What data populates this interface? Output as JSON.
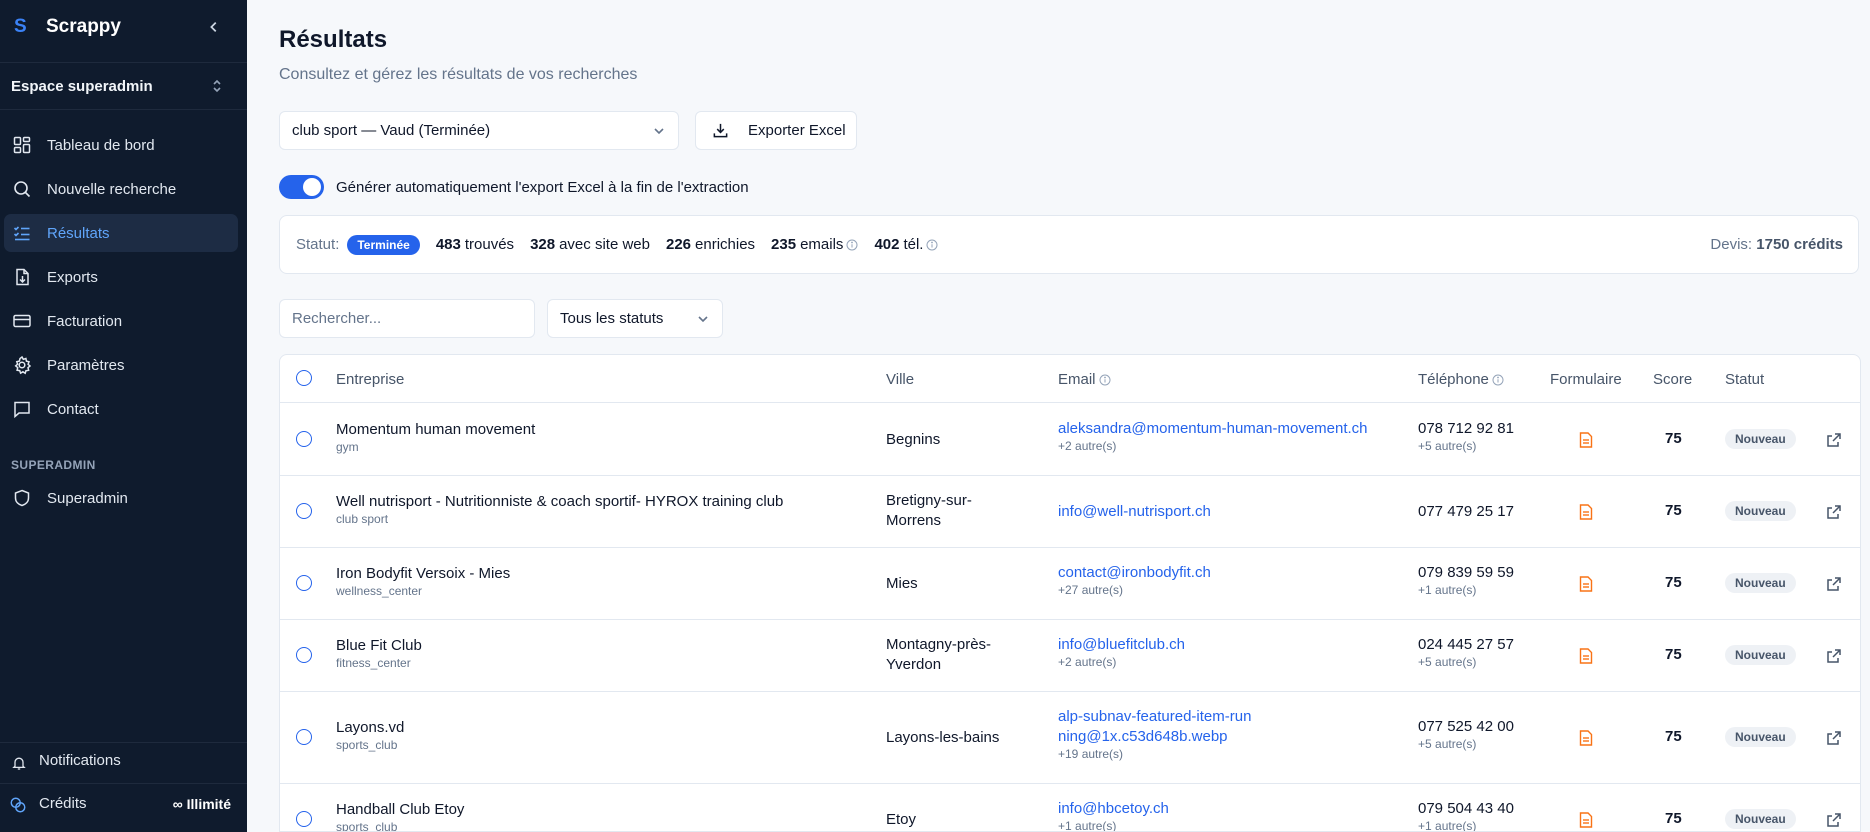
{
  "sidebar": {
    "logo": "S",
    "app_name": "Scrappy",
    "workspace": "Espace superadmin",
    "nav": [
      {
        "label": "Tableau de bord",
        "icon": "dashboard-icon"
      },
      {
        "label": "Nouvelle recherche",
        "icon": "search-icon"
      },
      {
        "label": "Résultats",
        "icon": "list-check-icon",
        "active": true
      },
      {
        "label": "Exports",
        "icon": "file-download-icon"
      },
      {
        "label": "Facturation",
        "icon": "credit-card-icon"
      },
      {
        "label": "Paramètres",
        "icon": "gear-icon"
      },
      {
        "label": "Contact",
        "icon": "chat-icon"
      }
    ],
    "section_label": "SUPERADMIN",
    "superadmin_label": "Superadmin",
    "notifications_label": "Notifications",
    "credits_label": "Crédits",
    "credits_value": "∞ Illimité"
  },
  "header": {
    "title": "Résultats",
    "subtitle": "Consultez et gérez les résultats de vos recherches"
  },
  "search_select": {
    "value": "club sport — Vaud (Terminée)"
  },
  "export_button": {
    "label": "Exporter Excel"
  },
  "auto_export": {
    "label": "Générer automatiquement l'export Excel à la fin de l'extraction",
    "enabled": true
  },
  "stats": {
    "status_label": "Statut:",
    "status_value": "Terminée",
    "found": {
      "value": "483",
      "label": "trouvés"
    },
    "with_site": {
      "value": "328",
      "label": "avec site web"
    },
    "enriched": {
      "value": "226",
      "label": "enrichies"
    },
    "emails": {
      "value": "235",
      "label": "emails"
    },
    "phones": {
      "value": "402",
      "label": "tél."
    },
    "quote_label": "Devis:",
    "quote_value": "1750 crédits"
  },
  "filters": {
    "search_placeholder": "Rechercher...",
    "status_value": "Tous les statuts"
  },
  "table": {
    "columns": {
      "company": "Entreprise",
      "city": "Ville",
      "email": "Email",
      "phone": "Téléphone",
      "form": "Formulaire",
      "score": "Score",
      "status": "Statut"
    },
    "rows": [
      {
        "name": "Momentum human movement",
        "category": "gym",
        "city": "Begnins",
        "email": "aleksandra@momentum-human-movement.ch",
        "email_more": "+2 autre(s)",
        "phone": "078 712 92 81",
        "phone_more": "+5 autre(s)",
        "score": "75",
        "status": "Nouveau"
      },
      {
        "name": "Well nutrisport - Nutritionniste & coach sportif- HYROX training club",
        "category": "club sport",
        "city": "Bretigny-sur-Morrens",
        "email": "info@well-nutrisport.ch",
        "email_more": "",
        "phone": "077 479 25 17",
        "phone_more": "",
        "score": "75",
        "status": "Nouveau"
      },
      {
        "name": "Iron Bodyfit Versoix - Mies",
        "category": "wellness_center",
        "city": "Mies",
        "email": "contact@ironbodyfit.ch",
        "email_more": "+27 autre(s)",
        "phone": "079 839 59 59",
        "phone_more": "+1 autre(s)",
        "score": "75",
        "status": "Nouveau"
      },
      {
        "name": "Blue Fit Club",
        "category": "fitness_center",
        "city": "Montagny-près-Yverdon",
        "email": "info@bluefitclub.ch",
        "email_more": "+2 autre(s)",
        "phone": "024 445 27 57",
        "phone_more": "+5 autre(s)",
        "score": "75",
        "status": "Nouveau"
      },
      {
        "name": "Layons.vd",
        "category": "sports_club",
        "city": "Layons-les-bains",
        "email": "alp-subnav-featured-item-running@1x.c53d648b.webp",
        "email_more": "+19 autre(s)",
        "phone": "077 525 42 00",
        "phone_more": "+5 autre(s)",
        "score": "75",
        "status": "Nouveau"
      },
      {
        "name": "Handball Club Etoy",
        "category": "sports_club",
        "city": "Etoy",
        "email": "info@hbcetoy.ch",
        "email_more": "+1 autre(s)",
        "phone": "079 504 43 40",
        "phone_more": "+1 autre(s)",
        "score": "75",
        "status": "Nouveau"
      }
    ]
  }
}
